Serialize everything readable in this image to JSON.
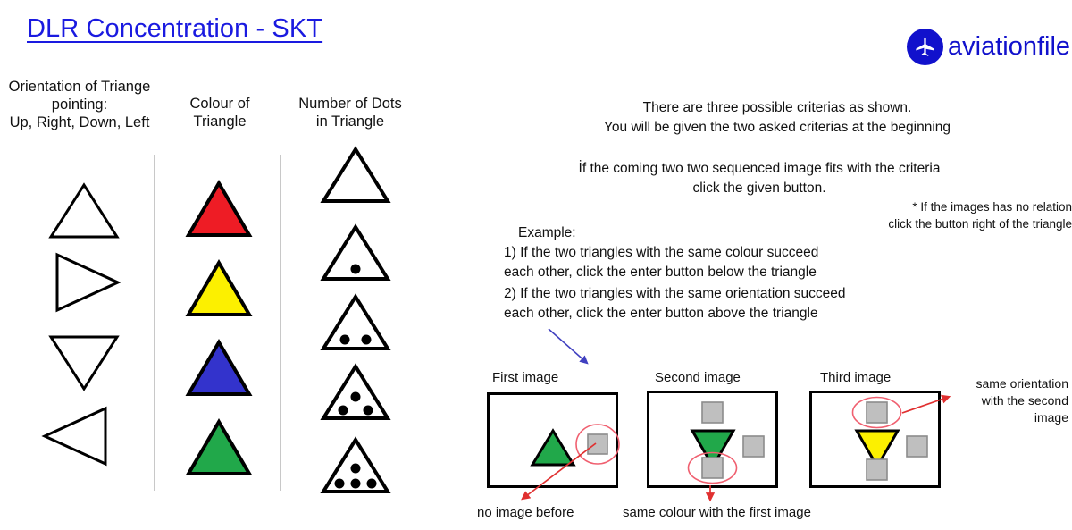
{
  "slide": {
    "title": "DLR Concentration - SKT",
    "title_color": "#1a1ae0",
    "background": "#ffffff"
  },
  "logo": {
    "name": "aviationfile",
    "icon": "airplane-icon",
    "circle_color": "#1111cc",
    "text_color": "#1111cc"
  },
  "criteria_columns": [
    {
      "heading": "Orientation of Triange\npointing:\nUp, Right, Down, Left",
      "items": [
        {
          "shape": "triangle",
          "orientation": "up",
          "fill": "none"
        },
        {
          "shape": "triangle",
          "orientation": "right",
          "fill": "none"
        },
        {
          "shape": "triangle",
          "orientation": "down",
          "fill": "none"
        },
        {
          "shape": "triangle",
          "orientation": "left",
          "fill": "none"
        }
      ]
    },
    {
      "heading": "Colour of\nTriangle",
      "items": [
        {
          "shape": "triangle",
          "orientation": "up",
          "colour_name": "red",
          "fill": "#ee1c25"
        },
        {
          "shape": "triangle",
          "orientation": "up",
          "colour_name": "yellow",
          "fill": "#fcf000"
        },
        {
          "shape": "triangle",
          "orientation": "up",
          "colour_name": "blue",
          "fill": "#3333cc"
        },
        {
          "shape": "triangle",
          "orientation": "up",
          "colour_name": "green",
          "fill": "#21a84a"
        }
      ]
    },
    {
      "heading": "Number of Dots\nin Triangle",
      "items": [
        {
          "shape": "triangle",
          "orientation": "up",
          "dots": 0
        },
        {
          "shape": "triangle",
          "orientation": "up",
          "dots": 1
        },
        {
          "shape": "triangle",
          "orientation": "up",
          "dots": 2
        },
        {
          "shape": "triangle",
          "orientation": "up",
          "dots": 3
        },
        {
          "shape": "triangle",
          "orientation": "up",
          "dots": 4
        }
      ]
    }
  ],
  "instructions": {
    "intro": "There are three possible criterias as shown.\nYou will be given the two asked criterias at the beginning",
    "rule": "İf the coming two two sequenced image fits with the criteria\nclick the given button.",
    "footnote": "* If the images has no relation\nclick the button right of the triangle",
    "example_heading": "Example:",
    "example_items": [
      "1) If the two triangles with the same colour succeed\n    each other, click the enter button below the triangle",
      "2) If the two triangles with the same orientation succeed\n    each other, click the enter button  above  the triangle"
    ]
  },
  "examples": {
    "boxes": [
      {
        "label": "First image",
        "triangle": {
          "orientation": "up",
          "fill": "#21a84a"
        },
        "squares": [
          {
            "position": "right",
            "highlighted": true
          }
        ],
        "caption": "no image before"
      },
      {
        "label": "Second image",
        "triangle": {
          "orientation": "down",
          "fill": "#21a84a"
        },
        "squares": [
          {
            "position": "top",
            "highlighted": false
          },
          {
            "position": "right",
            "highlighted": false
          },
          {
            "position": "bottom",
            "highlighted": true
          }
        ],
        "caption": "same colour with the first image"
      },
      {
        "label": "Third image",
        "triangle": {
          "orientation": "down",
          "fill": "#fcf000"
        },
        "squares": [
          {
            "position": "top",
            "highlighted": true
          },
          {
            "position": "right",
            "highlighted": false
          },
          {
            "position": "bottom",
            "highlighted": false
          }
        ],
        "caption": "same orientation\nwith the second\nimage"
      }
    ],
    "highlight_color": "#f06070",
    "arrow_color": "#e03030",
    "button_fill": "#bfbfbf",
    "pointer_arrow_color": "#4040c0"
  }
}
